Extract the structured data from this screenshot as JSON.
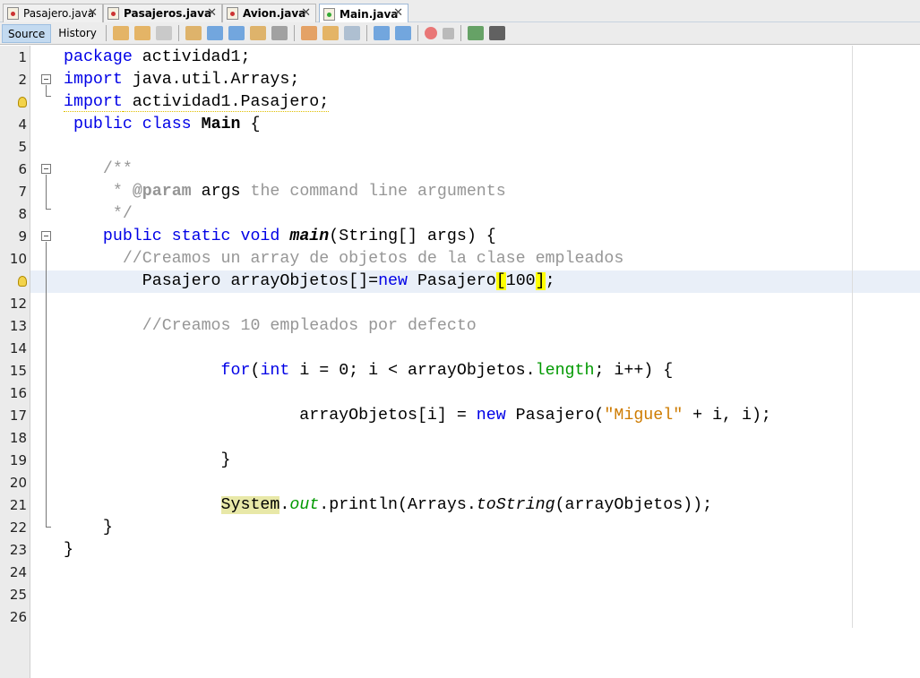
{
  "tabs": [
    {
      "label": "Pasajero.java",
      "bold": false,
      "active": false
    },
    {
      "label": "Pasajeros.java",
      "bold": true,
      "active": false
    },
    {
      "label": "Avion.java",
      "bold": true,
      "active": false
    },
    {
      "label": "Main.java",
      "bold": true,
      "active": true
    }
  ],
  "close_glyph": "✕",
  "toolbar": {
    "source": "Source",
    "history": "History",
    "icons": [
      "last-edit-icon",
      "back-icon",
      "forward-icon",
      "find-icon",
      "find-previous-icon",
      "find-next-icon",
      "toggle-highlight-icon",
      "toggle-rect-selection-icon",
      "previous-bookmark-icon",
      "next-bookmark-icon",
      "toggle-bookmark-icon",
      "shift-left-icon",
      "shift-right-icon",
      "start-macro-icon",
      "stop-macro-icon",
      "comment-icon",
      "uncomment-icon"
    ]
  },
  "colors": {
    "keyword": "#0000e6",
    "comment": "#969696",
    "string": "#ce7b00",
    "field": "#009900",
    "current_line": "#e9eff8",
    "bracket_match": "#ffff00"
  },
  "current_line": 11,
  "lines": [
    [
      [
        "package",
        "kw"
      ],
      [
        " actividad1;",
        ""
      ]
    ],
    [
      [
        "import",
        "kw"
      ],
      [
        " java.util.Arrays;",
        ""
      ]
    ],
    [
      [
        "import",
        "kw warn"
      ],
      [
        " actividad1.Pasajero;",
        "warn"
      ]
    ],
    [
      [
        " ",
        ""
      ],
      [
        "public",
        "kw"
      ],
      [
        " ",
        ""
      ],
      [
        "class",
        "kw"
      ],
      [
        " ",
        ""
      ],
      [
        "Main",
        "bold"
      ],
      [
        " {",
        ""
      ]
    ],
    [],
    [
      [
        "    ",
        ""
      ],
      [
        "/**",
        "cm"
      ]
    ],
    [
      [
        "     ",
        ""
      ],
      [
        "* ",
        "cm"
      ],
      [
        "@param",
        "cmb"
      ],
      [
        " args",
        ""
      ],
      [
        " the command line arguments",
        "cm"
      ]
    ],
    [
      [
        "     ",
        ""
      ],
      [
        "*/",
        "cm"
      ]
    ],
    [
      [
        "    ",
        ""
      ],
      [
        "public static void",
        "kw"
      ],
      [
        " ",
        ""
      ],
      [
        "main",
        "bi"
      ],
      [
        "(String[] args) {",
        ""
      ]
    ],
    [
      [
        "      ",
        ""
      ],
      [
        "//Creamos un array de objetos de la clase empleados",
        "cm"
      ]
    ],
    [
      [
        "        Pasajero arrayObjetos[]=",
        ""
      ],
      [
        "new",
        "kw"
      ],
      [
        " Pasajero",
        ""
      ],
      [
        "[",
        "hl"
      ],
      [
        "100",
        ""
      ],
      [
        "]",
        "hl"
      ],
      [
        ";",
        ""
      ]
    ],
    [],
    [
      [
        "        ",
        ""
      ],
      [
        "//Creamos 10 empleados por defecto",
        "cm"
      ]
    ],
    [],
    [
      [
        "                ",
        ""
      ],
      [
        "for",
        "kw"
      ],
      [
        "(",
        ""
      ],
      [
        "int",
        "kw"
      ],
      [
        " i = 0; i < arrayObjetos.",
        ""
      ],
      [
        "length",
        "fld"
      ],
      [
        "; i++) {",
        ""
      ]
    ],
    [],
    [
      [
        "                        arrayObjetos[i] = ",
        ""
      ],
      [
        "new",
        "kw"
      ],
      [
        " Pasajero(",
        ""
      ],
      [
        "\"Miguel\"",
        "str"
      ],
      [
        " + i, i);",
        ""
      ]
    ],
    [],
    [
      [
        "                }",
        ""
      ]
    ],
    [],
    [
      [
        "                ",
        ""
      ],
      [
        "System",
        "sys"
      ],
      [
        ".",
        ""
      ],
      [
        "out",
        "fi"
      ],
      [
        ".println(Arrays.",
        ""
      ],
      [
        "toString",
        "it"
      ],
      [
        "(arrayObjetos));",
        ""
      ]
    ],
    [
      [
        "    }",
        ""
      ]
    ],
    [
      [
        "}",
        ""
      ]
    ],
    [],
    [],
    []
  ]
}
